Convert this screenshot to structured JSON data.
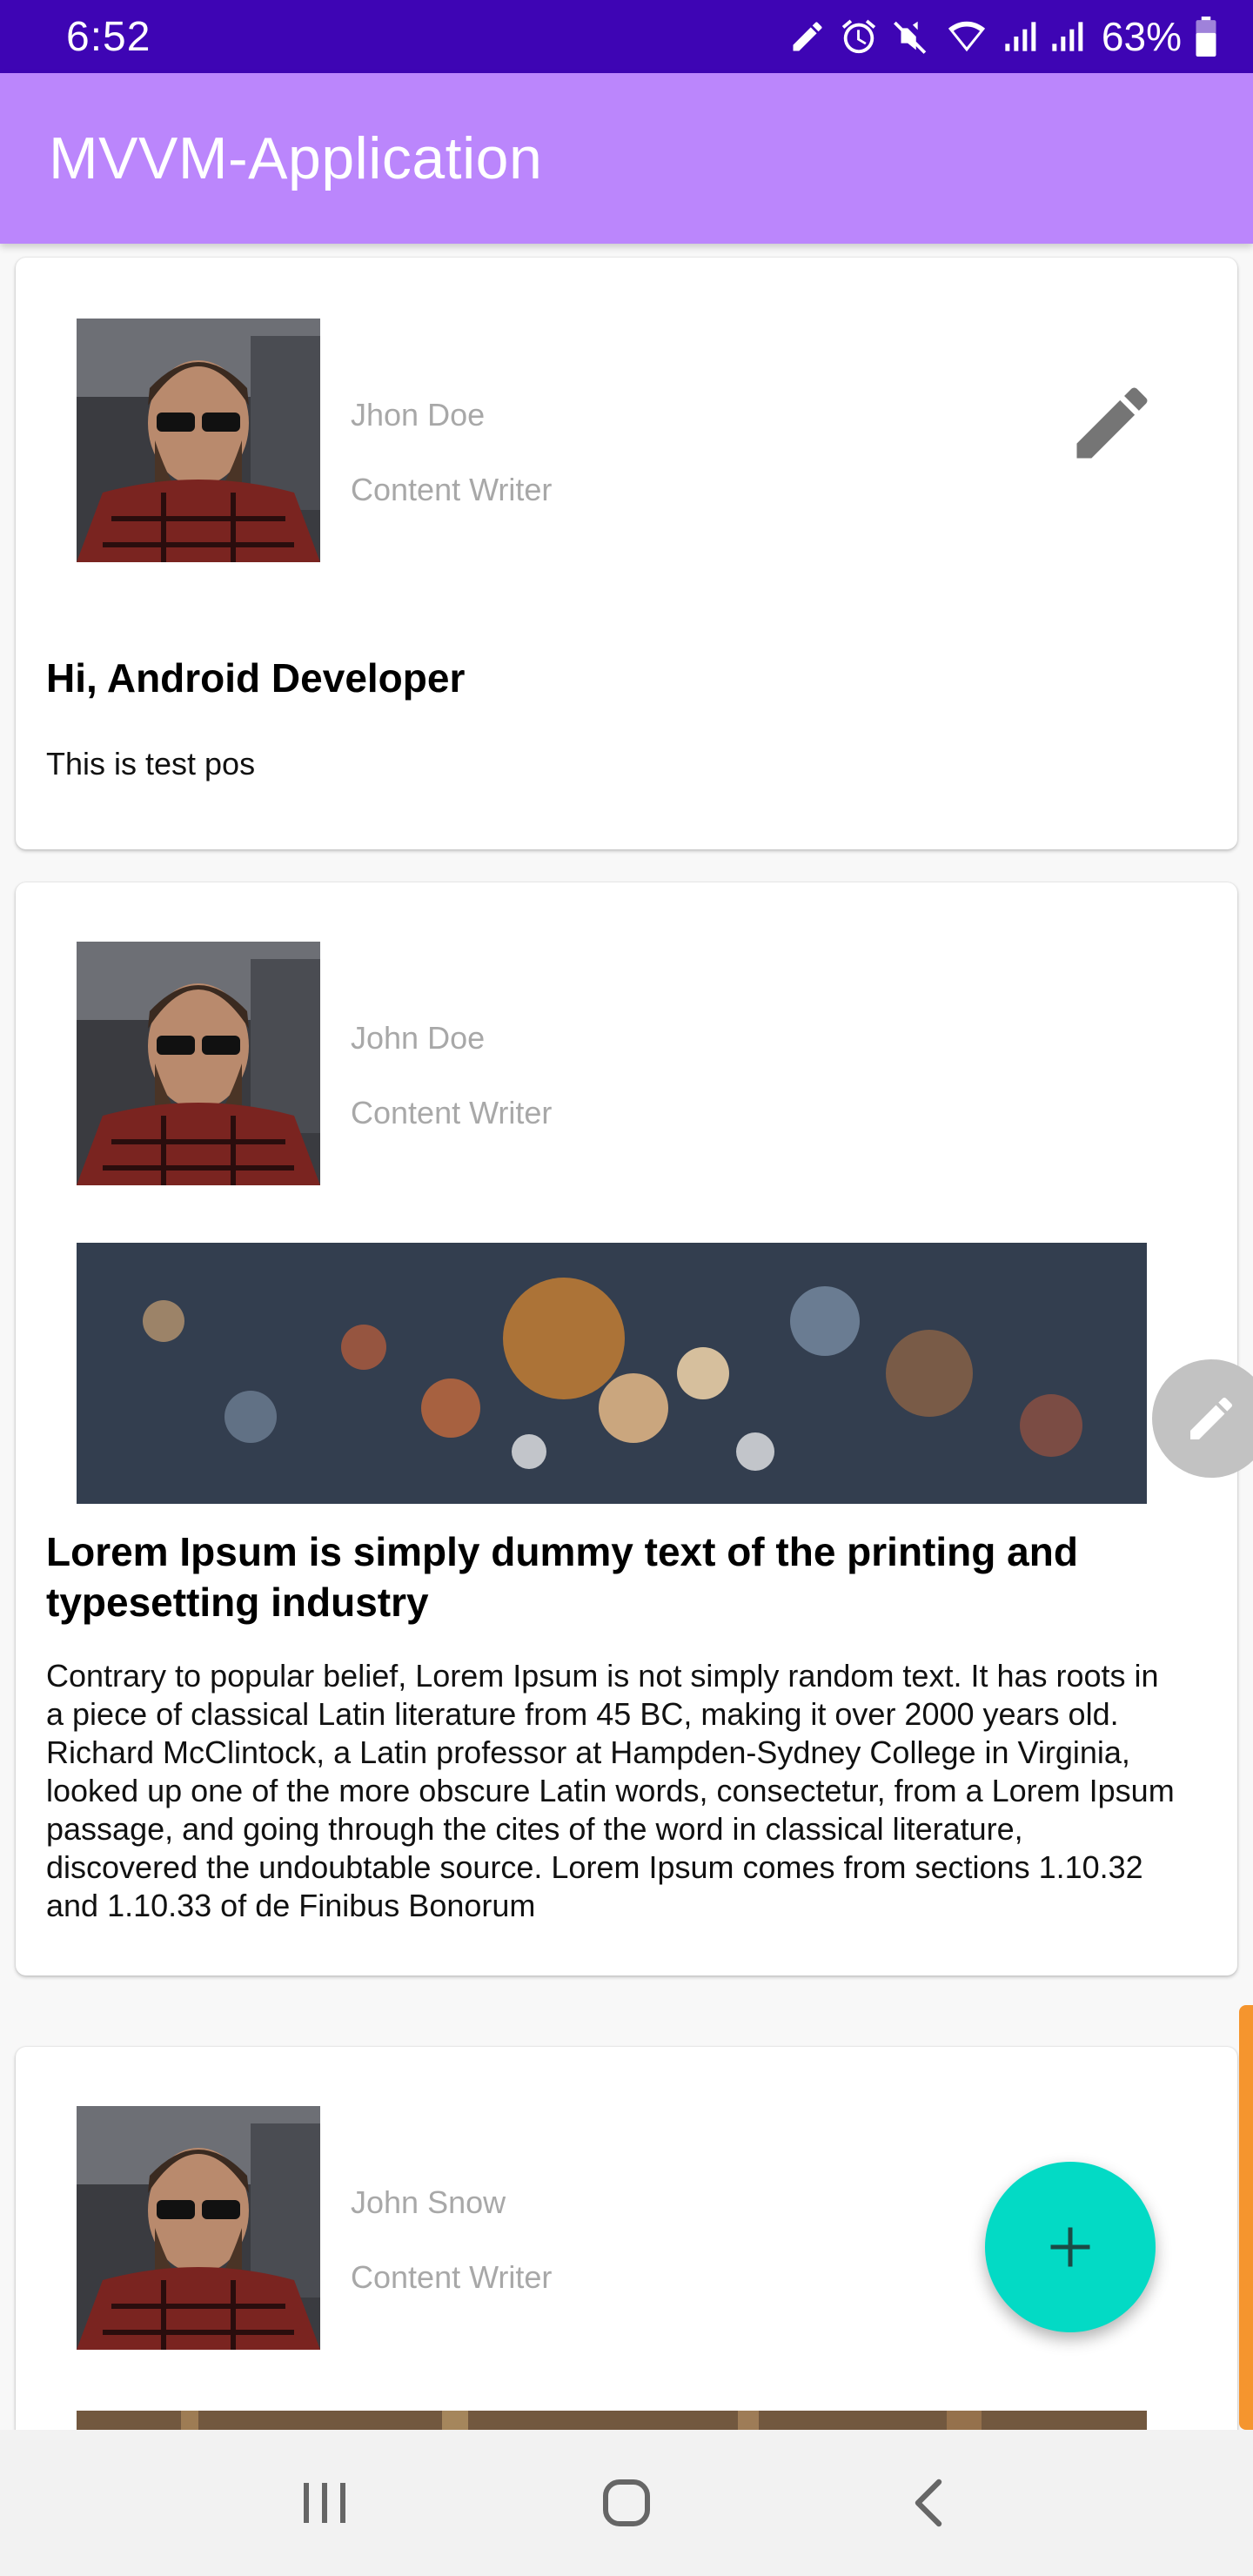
{
  "status_bar": {
    "time": "6:52",
    "battery": "63%",
    "icons": [
      "edit-icon",
      "alarm-icon",
      "vibrate-mute-icon",
      "wifi-icon",
      "signal-icon",
      "signal-icon",
      "battery-icon"
    ]
  },
  "app_bar": {
    "title": "MVVM-Application"
  },
  "posts": [
    {
      "author": "Jhon Doe",
      "role": "Content Writer",
      "title": "Hi, Android Developer",
      "body": "This is test pos",
      "has_image": false
    },
    {
      "author": "John Doe",
      "role": "Content Writer",
      "title": "Lorem Ipsum is simply dummy text of the printing and typesetting industry",
      "body": "Contrary to popular belief, Lorem Ipsum is not simply random text. It has roots in a piece of classical Latin literature from 45 BC, making it over 2000 years old. Richard McClintock, a Latin professor at Hampden-Sydney College in Virginia, looked up one of the more obscure Latin words, consectetur, from a Lorem Ipsum passage, and going through the cites of the word in classical literature, discovered the undoubtable source. Lorem Ipsum comes from sections 1.10.32 and 1.10.33 of de Finibus Bonorum",
      "has_image": true
    },
    {
      "author": "John Snow",
      "role": "Content Writer",
      "has_image": true
    }
  ],
  "fab": {
    "icon": "plus-icon"
  },
  "nav_bar": {
    "buttons": [
      "recents-icon",
      "home-icon",
      "back-icon"
    ]
  },
  "colors": {
    "status_bar": "#3e05b4",
    "app_bar": "#bb86fc",
    "fab": "#03dac5",
    "scroll_indicator": "#f5952e"
  }
}
